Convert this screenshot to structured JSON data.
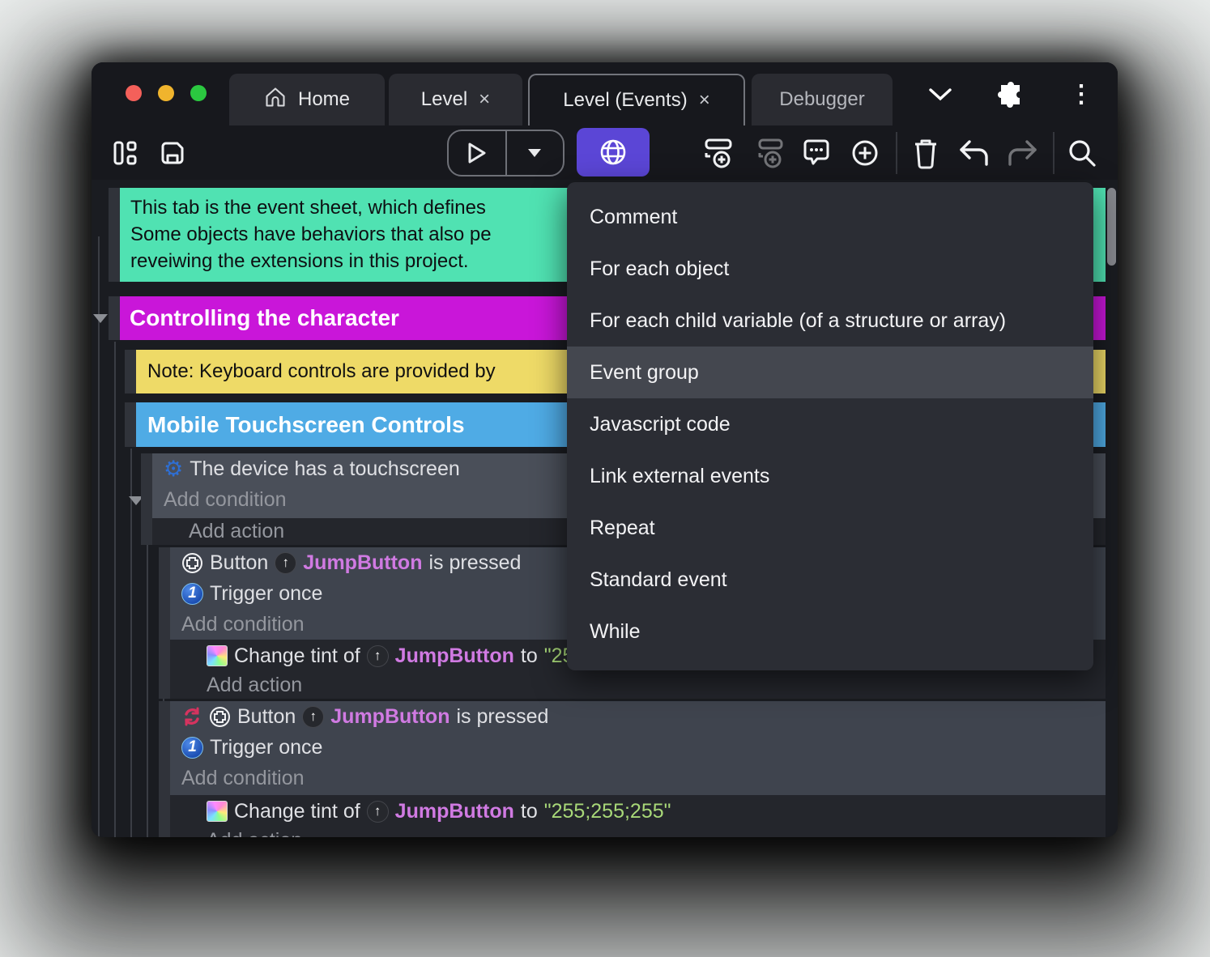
{
  "tabs": {
    "home": "Home",
    "level": "Level",
    "level_events": "Level (Events)",
    "debugger": "Debugger",
    "close_glyph": "×"
  },
  "menu": {
    "items": [
      "Comment",
      "For each object",
      "For each child variable (of a structure or array)",
      "Event group",
      "Javascript code",
      "Link external events",
      "Repeat",
      "Standard event",
      "While"
    ],
    "highlighted_item": "Event group"
  },
  "sheet": {
    "comment_line1": "This tab is the event sheet, which defines",
    "comment_line2": "Some objects have behaviors that also pe",
    "comment_line3": "reveiwing the extensions in this project.",
    "group_controlling": "Controlling the character",
    "note": "Note: Keyboard controls are provided by",
    "group_mobile": "Mobile Touchscreen Controls",
    "cond_touchscreen": "The device has a touchscreen",
    "add_condition": "Add condition",
    "add_action": "Add action",
    "button_label": "Button",
    "object_name": "JumpButton",
    "is_pressed": "is pressed",
    "trigger_once": "Trigger once",
    "change_tint": "Change tint of",
    "to_label": "to",
    "tint_value": "\"255;255;255\"",
    "trigger_one_glyph": "1",
    "gear_glyph": "⚙",
    "arrow_up_glyph": "↑"
  },
  "colors": {
    "comment_green": "#50e2b2",
    "group_magenta": "#c916d9",
    "note_yellow": "#eeda67",
    "group_blue": "#4fabe5",
    "accent_purple": "#5b46d6",
    "object_pink": "#d07ae2",
    "string_green": "#a8d878",
    "menu_bg": "#2b2d34",
    "menu_highlight": "#44474f"
  }
}
